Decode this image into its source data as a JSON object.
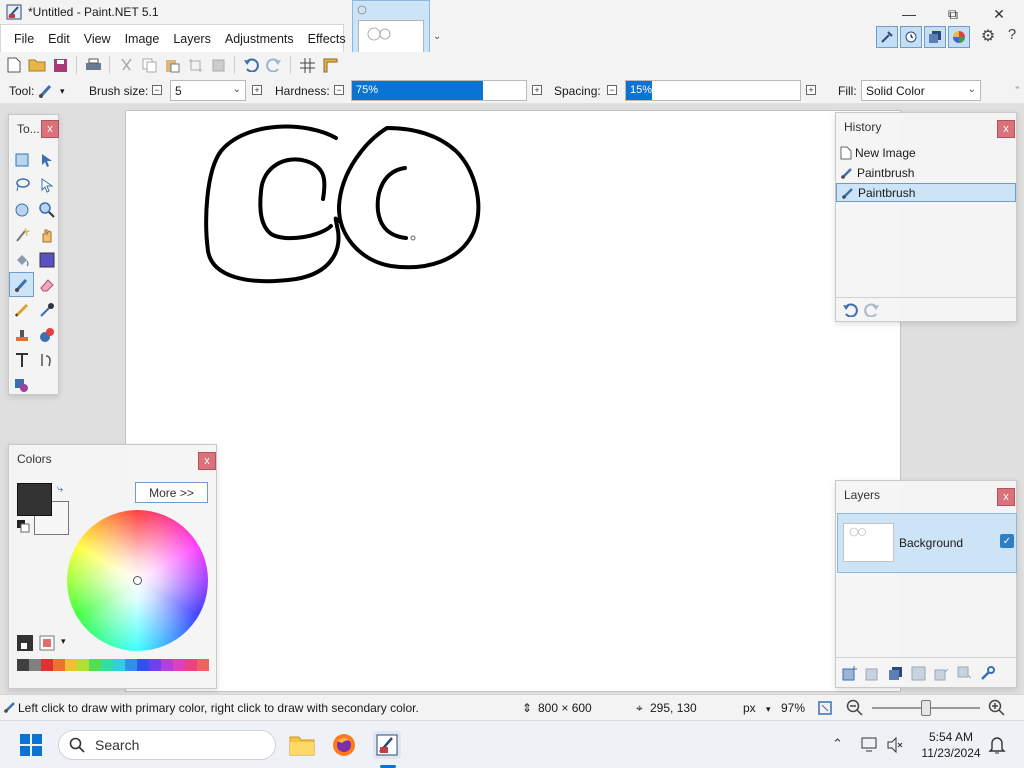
{
  "window": {
    "title": "*Untitled - Paint.NET 5.1",
    "controls": {
      "minimize": "—",
      "maximize": "⧉",
      "close": "✕"
    }
  },
  "menu": {
    "items": [
      "File",
      "Edit",
      "View",
      "Image",
      "Layers",
      "Adjustments",
      "Effects"
    ]
  },
  "toolbar_options": {
    "tool_label": "Tool:",
    "brush_size_label": "Brush size:",
    "brush_size_value": "5",
    "hardness_label": "Hardness:",
    "hardness_value": "75%",
    "hardness_fraction": 0.75,
    "spacing_label": "Spacing:",
    "spacing_value": "15%",
    "spacing_fraction": 0.15,
    "fill_label": "Fill:",
    "fill_value": "Solid Color"
  },
  "tools_panel": {
    "title": "To...",
    "close": "x",
    "tools": [
      "rectangle-select-icon",
      "move-selection-icon",
      "lasso-select-icon",
      "move-selected-icon",
      "ellipse-select-icon",
      "zoom-icon",
      "magic-wand-icon",
      "pan-icon",
      "paint-bucket-icon",
      "gradient-icon",
      "paintbrush-icon",
      "eraser-icon",
      "pencil-icon",
      "color-picker-icon",
      "clone-stamp-icon",
      "recolor-icon",
      "text-icon",
      "line-curve-icon",
      "shapes-icon"
    ],
    "selected_tool": "paintbrush-icon"
  },
  "history_panel": {
    "title": "History",
    "close": "x",
    "items": [
      {
        "label": "New Image",
        "icon": "new-image-icon",
        "selected": false
      },
      {
        "label": "Paintbrush",
        "icon": "paintbrush-icon",
        "selected": false
      },
      {
        "label": "Paintbrush",
        "icon": "paintbrush-icon",
        "selected": true
      }
    ]
  },
  "colors_panel": {
    "title": "Colors",
    "close": "x",
    "more_button": "More >>",
    "primary_color": "#333333",
    "secondary_color": "#f7f7f7",
    "palette": [
      "#404040",
      "#808080",
      "#e03030",
      "#f07030",
      "#f0c030",
      "#b0e030",
      "#50e050",
      "#30e0a0",
      "#30d0e0",
      "#3090f0",
      "#3050f0",
      "#7040f0",
      "#b040e0",
      "#e040c0",
      "#f04080",
      "#f06060"
    ]
  },
  "layers_panel": {
    "title": "Layers",
    "close": "x",
    "layers": [
      {
        "name": "Background",
        "visible": true
      }
    ]
  },
  "statusbar": {
    "hint": "Left click to draw with primary color, right click to draw with secondary color.",
    "image_size": "800 × 600",
    "cursor_pos": "295, 130",
    "units": "px",
    "zoom": "97%"
  },
  "taskbar": {
    "search_label": "Search",
    "time": "5:54 AM",
    "date": "11/23/2024"
  }
}
